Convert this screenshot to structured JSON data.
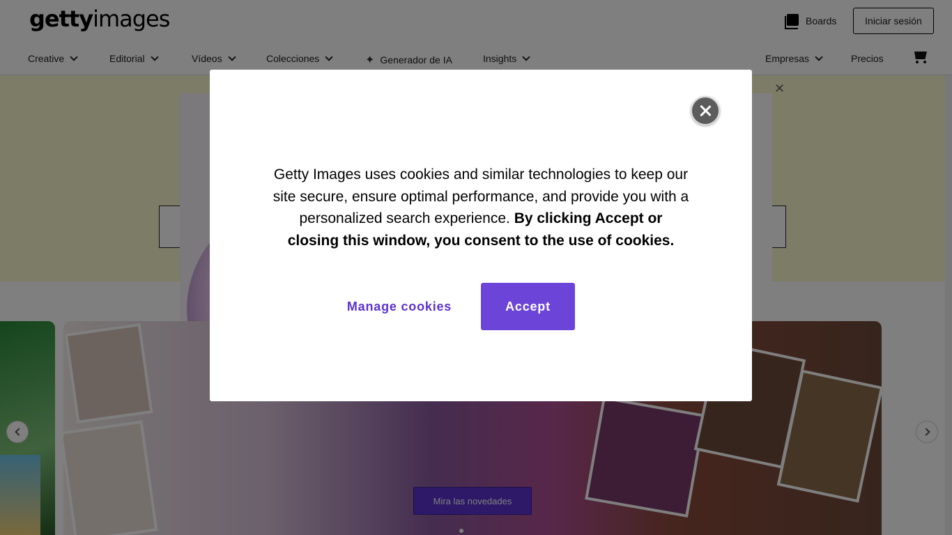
{
  "header": {
    "logo_bold": "getty",
    "logo_light": "images",
    "boards_label": "Boards",
    "login_label": "Iniciar sesión"
  },
  "nav": {
    "creative": "Creative",
    "editorial": "Editorial",
    "videos": "Vídeos",
    "colecciones": "Colecciones",
    "ai_generator": "Generador de IA",
    "insights": "Insights",
    "empresas": "Empresas",
    "precios": "Precios"
  },
  "hero": {
    "close_glyph": "✕"
  },
  "carousel": {
    "cta_label": "Mira las novedades"
  },
  "cookie_modal": {
    "text_plain": "Getty Images uses cookies and similar technologies to keep our site secure, ensure optimal performance, and provide you with a personalized search experience. ",
    "text_bold": "By clicking Accept or closing this window, you consent to the use of cookies.",
    "manage_label": "Manage cookies",
    "accept_label": "Accept"
  },
  "colors": {
    "accent": "#6c44d8",
    "link": "#5b32d1",
    "hero_bg": "#f8f8cf"
  },
  "icons": {
    "boards": "boards-icon",
    "cart": "cart-icon",
    "ai_spark": "sparkle-icon",
    "modal_close": "close-icon",
    "chevron": "chevron-down-icon"
  }
}
